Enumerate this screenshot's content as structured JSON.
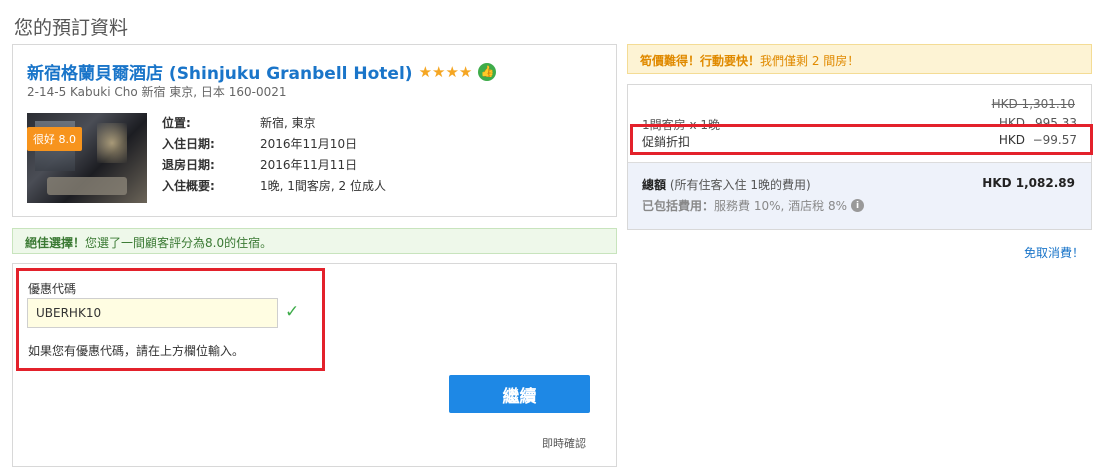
{
  "page": {
    "title": "您的預訂資料"
  },
  "hotel": {
    "name": "新宿格蘭貝爾酒店 (Shinjuku Granbell Hotel)",
    "stars": "★★★★",
    "star_rating": 4,
    "address": "2-14-5 Kabuki Cho 新宿 東京, 日本 160-0021",
    "rating_badge": "很好 8.0",
    "details": [
      {
        "label": "位置:",
        "value": "新宿, 東京"
      },
      {
        "label": "入住日期:",
        "value": "2016年11月10日"
      },
      {
        "label": "退房日期:",
        "value": "2016年11月11日"
      },
      {
        "label": "入住概要:",
        "value": "1晚, 1間客房, 2 位成人"
      }
    ]
  },
  "great_choice": {
    "bold": "絕佳選擇！",
    "text": "您選了一間顧客評分為8.0的住宿。"
  },
  "promo": {
    "label": "優惠代碼",
    "value": "UBERHK10",
    "hint": "如果您有優惠代碼，請在上方欄位輸入。",
    "continue_label": "繼續",
    "instant_confirm": "即時確認"
  },
  "urgency": {
    "bold": "筍價難得！行動要快！",
    "text": "我們僅剩 2 間房！"
  },
  "price": {
    "original": "HKD 1,301.10",
    "room_label": "1間客房 x 1晚",
    "room_currency": "HKD",
    "room_amount": "995.33",
    "discount_label": "促銷折扣",
    "discount_currency": "HKD",
    "discount_amount": "−99.57",
    "total_bold": "總額",
    "total_note": "(所有住客入住 1晚的費用)",
    "total_value": "HKD 1,082.89",
    "included_bold": "已包括費用：",
    "included_text": "服務費 10%, 酒店稅 8%"
  },
  "cancel": {
    "label": "免取消費！"
  },
  "colors": {
    "accent": "#1e88e5",
    "highlight_red": "#e3212b",
    "rating_orange": "#f7941d",
    "success_green": "#3eac4a"
  }
}
